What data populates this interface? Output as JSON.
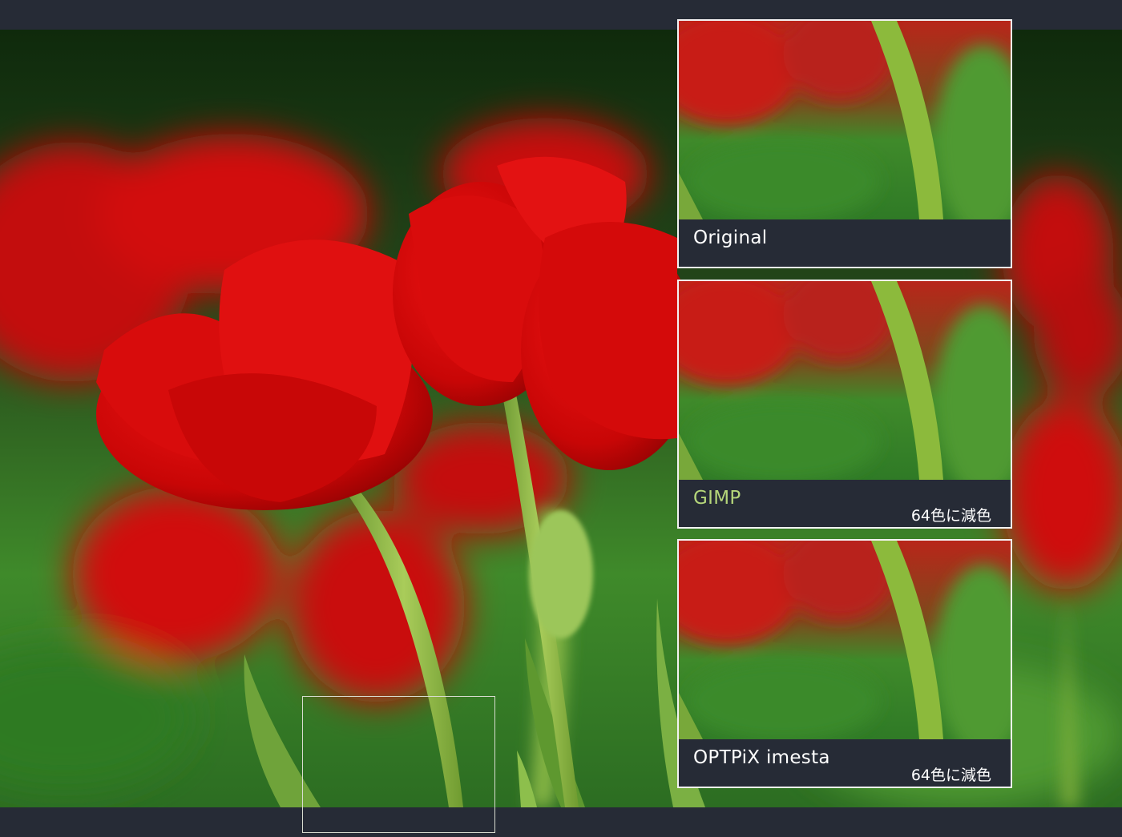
{
  "panels": [
    {
      "label": "Original",
      "note": ""
    },
    {
      "label": "GIMP",
      "note": "64色に減色"
    },
    {
      "label": "OPTPiX imesta",
      "note": "64色に減色"
    }
  ],
  "colors": {
    "bar": "#262b36",
    "frame": "#f2f2f2",
    "label_accent": "#b5d67a",
    "tulip_red": "#d40a0a",
    "stem_green": "#8cba3c"
  }
}
